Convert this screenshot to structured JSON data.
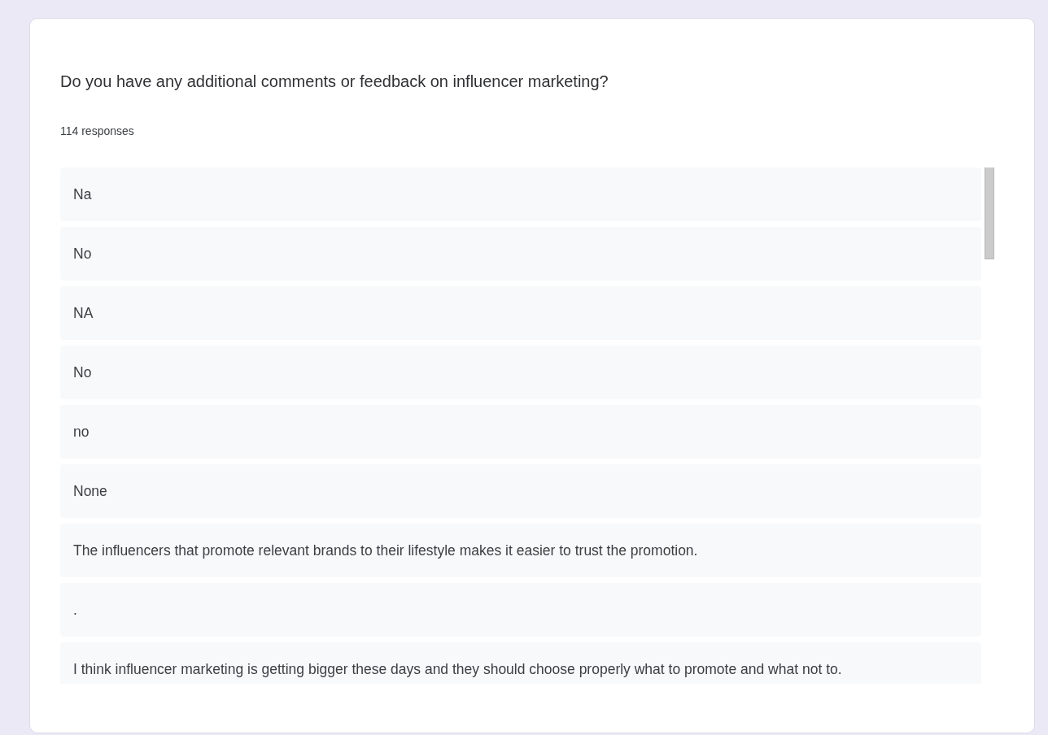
{
  "question": {
    "title": "Do you have any additional comments or feedback on influencer marketing?",
    "count": "114 responses",
    "responses": [
      "Na",
      "No",
      "NA",
      "No",
      "no",
      "None",
      "The influencers that promote relevant brands to their lifestyle makes it easier to trust the promotion.",
      ".",
      "I think influencer marketing is getting bigger these days and they should choose properly what to promote and what not to."
    ]
  }
}
